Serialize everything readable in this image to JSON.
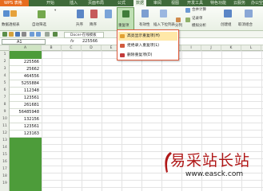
{
  "app": {
    "logo": "WPS 表格"
  },
  "menu_tabs": [
    "开始",
    "插入",
    "页面布局",
    "公式",
    "数据",
    "审阅",
    "视图",
    "开发工具",
    "特色功能",
    "云服务",
    "办公空间"
  ],
  "active_tab_index": 4,
  "ribbon": {
    "pivot": "数据透视表",
    "autofilter": "自动筛选",
    "sort_asc": "升序",
    "sort_desc": "降序",
    "duplicates": "重复项",
    "validity": "有效性",
    "dropdown_list": "插入下拉列表",
    "consolidate": "合并计算",
    "record": "记录单",
    "split": "分列",
    "what_if": "模拟分析",
    "create_group": "创建组",
    "ungroup": "取消组合"
  },
  "document_tab": "Docer-在线模板",
  "formula_bar": {
    "name_box": "A1",
    "fx": "fx",
    "value": "225566"
  },
  "columns": [
    "A",
    "B",
    "C",
    "D",
    "E",
    "F",
    "G",
    "H",
    "I",
    "J",
    "K",
    "L",
    "M"
  ],
  "rows": [
    "1",
    "2",
    "3",
    "4",
    "5",
    "6",
    "7",
    "8",
    "9",
    "10",
    "11",
    "12",
    "13",
    "14",
    "15",
    "16",
    "17",
    "18",
    "19"
  ],
  "cells_col_a": [
    "225566",
    "25662",
    "464556",
    "5255884",
    "112348",
    "123561",
    "261681",
    "56485948",
    "132156",
    "123561",
    "123163",
    "",
    "",
    ""
  ],
  "dropdown": {
    "items": [
      "高亮显示重复项(H)",
      "拒绝录入重复项(L)",
      "删除重复项(D)"
    ]
  },
  "watermark": {
    "text": "易采站长站",
    "url": "www.easck.com"
  }
}
